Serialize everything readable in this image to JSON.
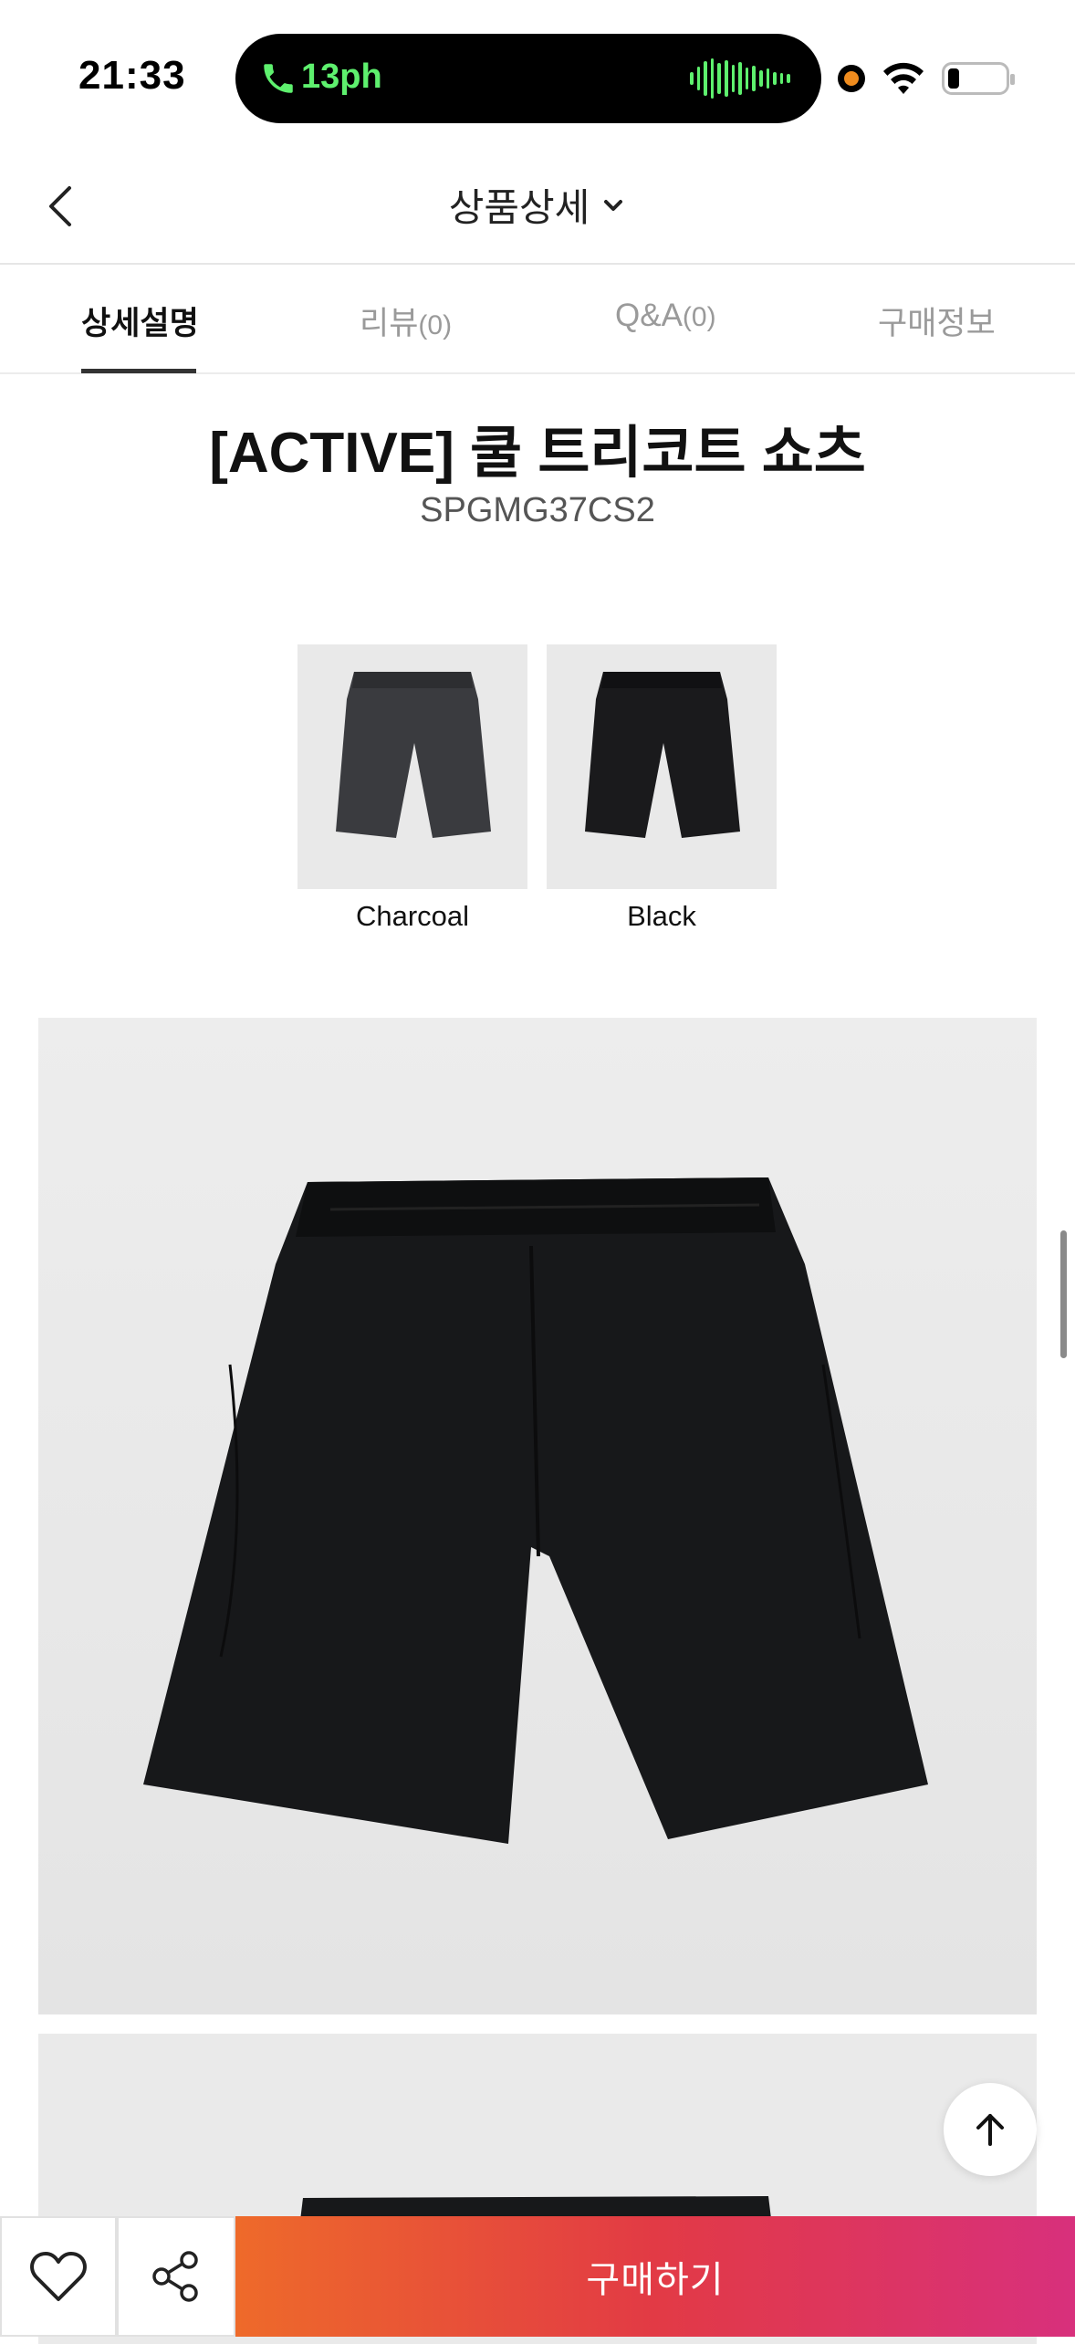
{
  "status_bar": {
    "time": "21:33",
    "call_duration": "13ph",
    "colors": {
      "call_green": "#5ef06e",
      "recording_dot": "#f08c1e"
    }
  },
  "header": {
    "title": "상품상세",
    "back_icon": "chevron-left-icon",
    "dropdown_icon": "chevron-down-icon"
  },
  "tabs": [
    {
      "label": "상세설명",
      "count": "",
      "active": true
    },
    {
      "label": "리뷰",
      "count": "(0)",
      "active": false
    },
    {
      "label": "Q&A",
      "count": "(0)",
      "active": false
    },
    {
      "label": "구매정보",
      "count": "",
      "active": false
    }
  ],
  "product": {
    "title": "[ACTIVE] 쿨 트리코트 쇼츠",
    "code": "SPGMG37CS2",
    "colors": [
      {
        "name": "Charcoal",
        "swatch_hex": "#3a3b3f"
      },
      {
        "name": "Black",
        "swatch_hex": "#1a1a1c"
      }
    ]
  },
  "bottom_bar": {
    "wishlist_icon": "heart-icon",
    "share_icon": "share-icon",
    "buy_label": "구매하기",
    "buy_gradient": [
      "#ee6a2a",
      "#e23a45",
      "#d8307c"
    ]
  },
  "floating": {
    "scroll_top_icon": "arrow-up-icon"
  }
}
